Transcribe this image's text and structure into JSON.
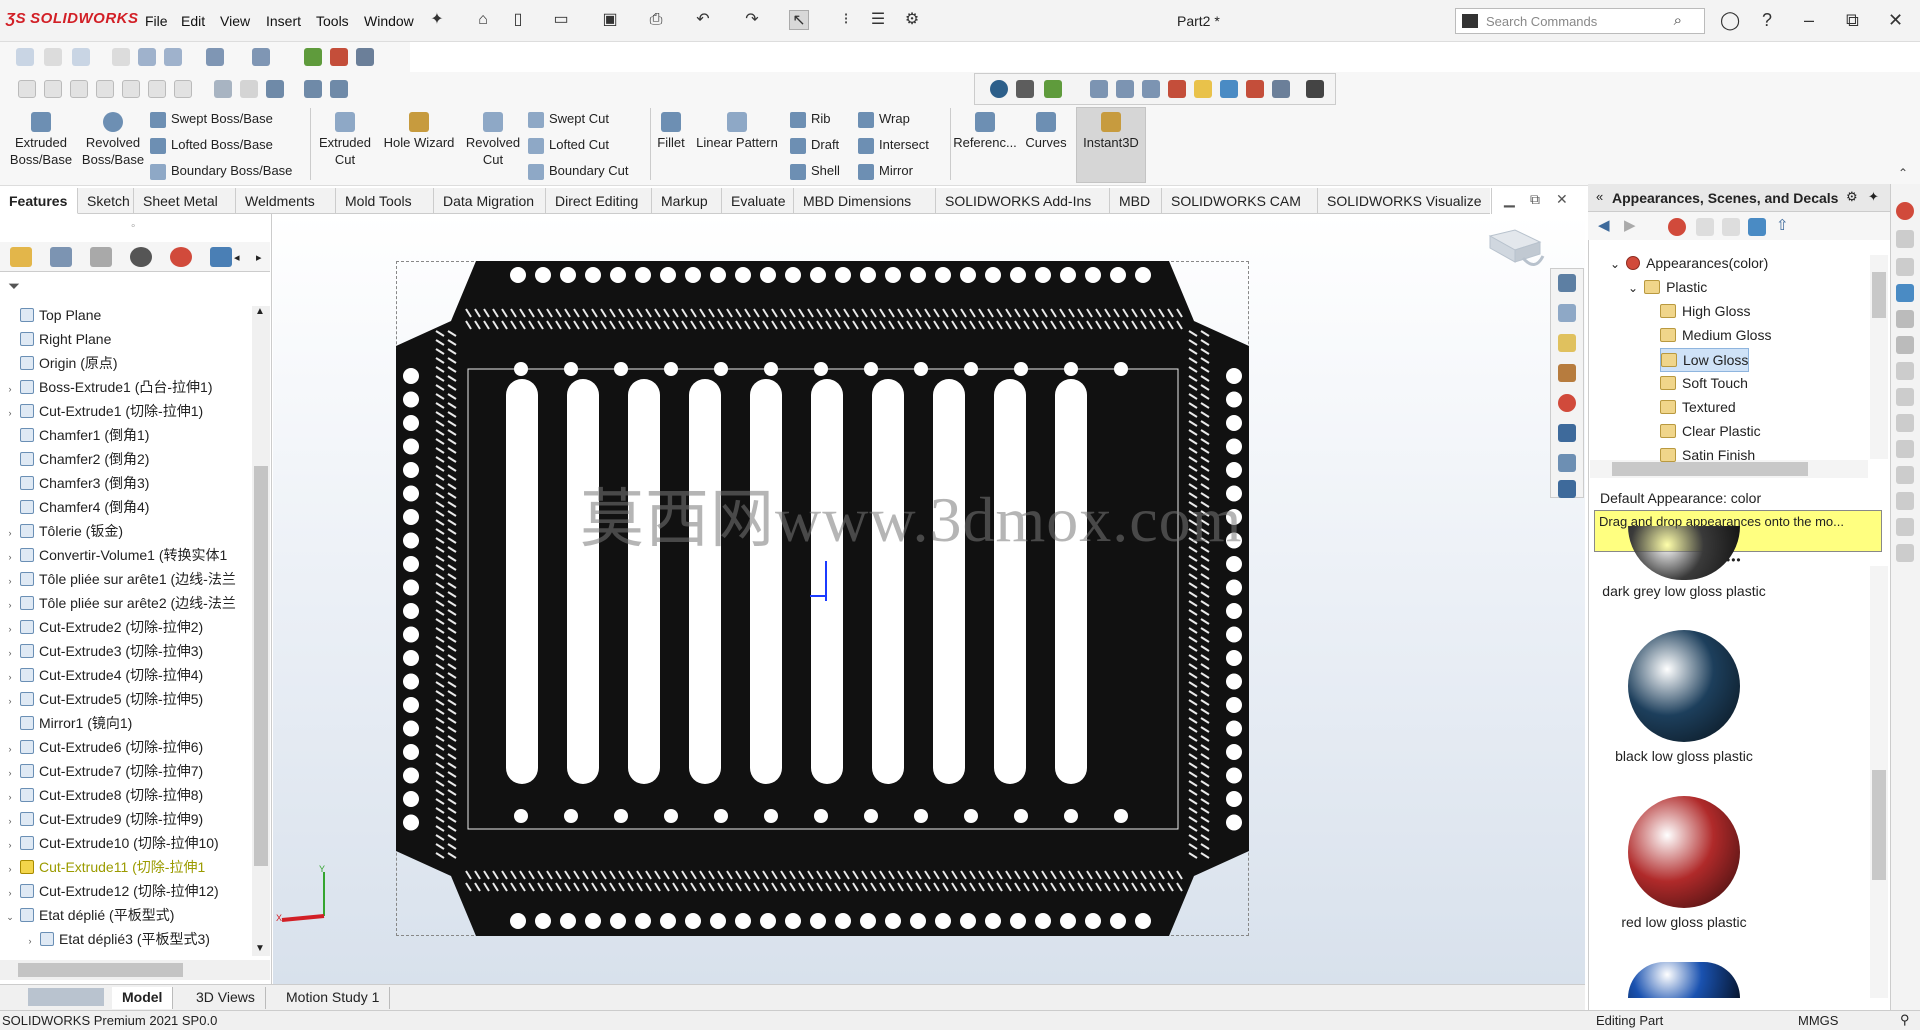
{
  "app": {
    "brand": "SOLIDWORKS",
    "doc_title": "Part2 *"
  },
  "menu": [
    "File",
    "Edit",
    "View",
    "Insert",
    "Tools",
    "Window"
  ],
  "search": {
    "placeholder": "Search Commands"
  },
  "window_controls": {
    "minimize": "–",
    "restore": "⧉",
    "close": "✕"
  },
  "commands": {
    "extruded_boss": "Extruded Boss/Base",
    "revolved_boss": "Revolved Boss/Base",
    "swept_boss": "Swept Boss/Base",
    "lofted_boss": "Lofted Boss/Base",
    "boundary_boss": "Boundary Boss/Base",
    "extruded_cut": "Extruded Cut",
    "hole_wizard": "Hole Wizard",
    "revolved_cut": "Revolved Cut",
    "swept_cut": "Swept Cut",
    "lofted_cut": "Lofted Cut",
    "boundary_cut": "Boundary Cut",
    "fillet": "Fillet",
    "linear_pattern": "Linear Pattern",
    "rib": "Rib",
    "draft": "Draft",
    "shell": "Shell",
    "wrap": "Wrap",
    "intersect": "Intersect",
    "mirror": "Mirror",
    "reference": "Referenc...",
    "curves": "Curves",
    "instant3d": "Instant3D"
  },
  "tabs": [
    "Features",
    "Sketch",
    "Sheet Metal",
    "Weldments",
    "Mold Tools",
    "Data Migration",
    "Direct Editing",
    "Markup",
    "Evaluate",
    "MBD Dimensions",
    "SOLIDWORKS Add-Ins",
    "MBD",
    "SOLIDWORKS CAM",
    "SOLIDWORKS Visualize"
  ],
  "tree": [
    {
      "label": "Top Plane",
      "expand": ""
    },
    {
      "label": "Right Plane",
      "expand": ""
    },
    {
      "label": "Origin (原点)",
      "expand": ""
    },
    {
      "label": "Boss-Extrude1 (凸台-拉伸1)",
      "expand": "›"
    },
    {
      "label": "Cut-Extrude1 (切除-拉伸1)",
      "expand": "›"
    },
    {
      "label": "Chamfer1 (倒角1)",
      "expand": ""
    },
    {
      "label": "Chamfer2 (倒角2)",
      "expand": ""
    },
    {
      "label": "Chamfer3 (倒角3)",
      "expand": ""
    },
    {
      "label": "Chamfer4 (倒角4)",
      "expand": ""
    },
    {
      "label": "Tôlerie (钣金)",
      "expand": "›"
    },
    {
      "label": "Convertir-Volume1 (转换实体1",
      "expand": "›"
    },
    {
      "label": "Tôle pliée sur arête1 (边线-法兰",
      "expand": "›"
    },
    {
      "label": "Tôle pliée sur arête2 (边线-法兰",
      "expand": "›"
    },
    {
      "label": "Cut-Extrude2 (切除-拉伸2)",
      "expand": "›"
    },
    {
      "label": "Cut-Extrude3 (切除-拉伸3)",
      "expand": "›"
    },
    {
      "label": "Cut-Extrude4 (切除-拉伸4)",
      "expand": "›"
    },
    {
      "label": "Cut-Extrude5 (切除-拉伸5)",
      "expand": "›"
    },
    {
      "label": "Mirror1 (镜向1)",
      "expand": ""
    },
    {
      "label": "Cut-Extrude6 (切除-拉伸6)",
      "expand": "›"
    },
    {
      "label": "Cut-Extrude7 (切除-拉伸7)",
      "expand": "›"
    },
    {
      "label": "Cut-Extrude8 (切除-拉伸8)",
      "expand": "›"
    },
    {
      "label": "Cut-Extrude9 (切除-拉伸9)",
      "expand": "›"
    },
    {
      "label": "Cut-Extrude10 (切除-拉伸10)",
      "expand": "›"
    },
    {
      "label": "Cut-Extrude11 (切除-拉伸1",
      "expand": "›",
      "warn": true
    },
    {
      "label": "Cut-Extrude12 (切除-拉伸12)",
      "expand": "›"
    },
    {
      "label": "Etat déplié (平板型式)",
      "expand": "⌄"
    },
    {
      "label": "Etat déplié3 (平板型式3)",
      "expand": "›"
    }
  ],
  "watermark": "莫西网www.3dmox.com",
  "right_panel": {
    "title": "Appearances, Scenes, and Decals",
    "tree": [
      {
        "label": "Appearances(color)"
      },
      {
        "label": "Plastic"
      },
      {
        "label": "High Gloss"
      },
      {
        "label": "Medium Gloss"
      },
      {
        "label": "Low Gloss",
        "selected": true
      },
      {
        "label": "Soft Touch"
      },
      {
        "label": "Textured"
      },
      {
        "label": "Clear Plastic"
      },
      {
        "label": "Satin Finish"
      }
    ],
    "default_appearance": "Default Appearance: color",
    "tip": "Drag and drop appearances onto the mo...",
    "swatches": [
      {
        "label": "dark grey low gloss plastic",
        "color": "#3a3a3a"
      },
      {
        "label": "black low gloss plastic",
        "color": "#1d3f5c"
      },
      {
        "label": "red low gloss plastic",
        "color": "#b02a2a"
      },
      {
        "label": "",
        "color": "#1a52b0"
      }
    ]
  },
  "bottom_tabs": [
    "Model",
    "3D Views",
    "Motion Study 1"
  ],
  "status": {
    "left": "SOLIDWORKS Premium 2021 SP0.0",
    "editing": "Editing Part",
    "units": "MMGS"
  }
}
